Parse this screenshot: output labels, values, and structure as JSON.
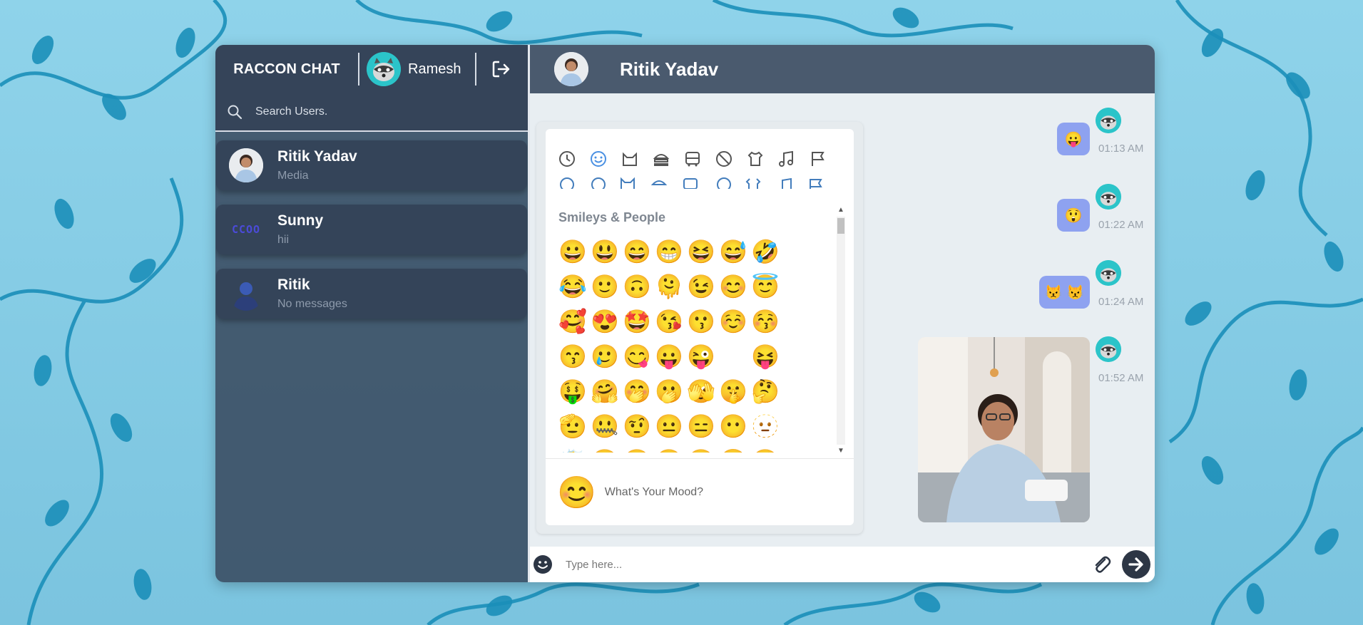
{
  "app": {
    "brand": "RACCON CHAT",
    "current_user": {
      "name": "Ramesh",
      "avatar_icon": "raccoon-icon"
    }
  },
  "search": {
    "placeholder": "Search Users."
  },
  "users": [
    {
      "name": "Ritik Yadav",
      "last_message": "Media",
      "avatar": "photo"
    },
    {
      "name": "Sunny",
      "last_message": "hii",
      "avatar": "ccoo-logo"
    },
    {
      "name": "Ritik",
      "last_message": "No messages",
      "avatar": "person-silhouette"
    }
  ],
  "chat": {
    "contact_name": "Ritik Yadav",
    "messages": [
      {
        "content": "😛",
        "time": "01:13 AM"
      },
      {
        "content": "😲",
        "time": "01:22 AM"
      },
      {
        "content": "😾 😾",
        "time": "01:24 AM"
      },
      {
        "content": "photo",
        "time": "01:52 AM"
      }
    ]
  },
  "emoji_picker": {
    "categories": [
      "recent-icon",
      "smileys-icon",
      "animals-icon",
      "food-icon",
      "travel-icon",
      "activities-icon",
      "objects-icon",
      "symbols-icon",
      "flags-icon"
    ],
    "section_title": "Smileys & People",
    "emojis": [
      [
        "😀",
        "😃",
        "😄",
        "😁",
        "😆",
        "😅",
        "🤣"
      ],
      [
        "😂",
        "🙂",
        "🙃",
        "🫠",
        "😉",
        "😊",
        "😇"
      ],
      [
        "🥰",
        "😍",
        "🤩",
        "😘",
        "😗",
        "☺️",
        "😚"
      ],
      [
        "😙",
        "🥲",
        "😋",
        "😛",
        "😜",
        "",
        "😝"
      ],
      [
        "🤑",
        "🤗",
        "🤭",
        "🫢",
        "🫣",
        "🤫",
        "🤔"
      ],
      [
        "🫡",
        "🤐",
        "🤨",
        "😐",
        "😑",
        "😶",
        "🫥"
      ],
      [
        "😶‍🌫️",
        "😏",
        "😒",
        "🙄",
        "😬",
        "😮‍💨",
        "🤥"
      ]
    ],
    "mood_emoji": "😊",
    "mood_prompt": "What's Your Mood?"
  },
  "composer": {
    "placeholder": "Type here..."
  },
  "colors": {
    "bubble": "#8ea2f0",
    "panel": "#344459",
    "header": "#4a5a6e",
    "accent": "#2bc4c9"
  }
}
